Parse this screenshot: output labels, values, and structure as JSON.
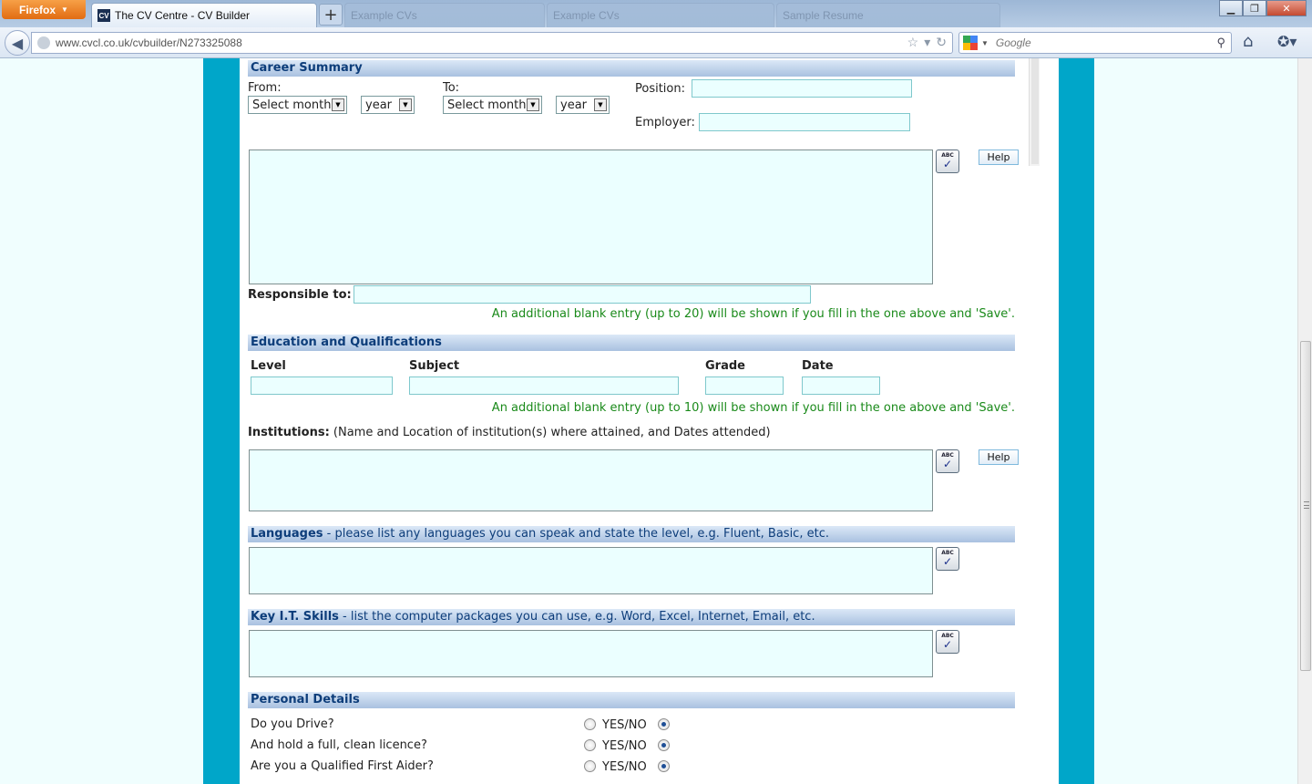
{
  "browser": {
    "menu_label": "Firefox",
    "active_tab": "The CV Centre - CV Builder",
    "favicon_text": "CV",
    "background_tabs": [
      "Example CVs",
      "Example CVs",
      "Sample Resume"
    ],
    "url": "www.cvcl.co.uk/cvbuilder/N273325088",
    "search_placeholder": "Google"
  },
  "career": {
    "title": "Career Summary",
    "from_label": "From:",
    "to_label": "To:",
    "month_placeholder": "Select month",
    "year_placeholder": "year",
    "position_label": "Position:",
    "employer_label": "Employer:",
    "responsible_label": "Responsible to:",
    "note": "An additional blank entry (up to 20) will be shown if you fill in the one above and 'Save'."
  },
  "education": {
    "title": "Education and Qualifications",
    "columns": [
      "Level",
      "Subject",
      "Grade",
      "Date"
    ],
    "note": "An additional blank entry (up to 10) will be shown if you fill in the one above and 'Save'.",
    "institutions_label": "Institutions:",
    "institutions_hint": " (Name and Location of institution(s) where attained, and Dates attended)"
  },
  "languages": {
    "title": "Languages",
    "subtitle": " - please list any languages you can speak and state the level, e.g. Fluent, Basic, etc."
  },
  "it_skills": {
    "title": "Key I.T. Skills",
    "subtitle": " - list the computer packages you can use, e.g. Word, Excel, Internet, Email, etc."
  },
  "personal": {
    "title": "Personal Details",
    "yesno_label": "YES/NO",
    "questions": [
      {
        "label": "Do you Drive?",
        "value": "no"
      },
      {
        "label": "And hold a full, clean licence?",
        "value": "no"
      },
      {
        "label": "Are you a Qualified First Aider?",
        "value": "no"
      }
    ]
  },
  "common": {
    "help_label": "Help",
    "spell_label": "ABC"
  },
  "colors": {
    "accent_stripe": "#00a6c9",
    "header_text": "#0d3d7a",
    "note_text": "#1a8a1a",
    "input_bg": "#ebffff"
  }
}
